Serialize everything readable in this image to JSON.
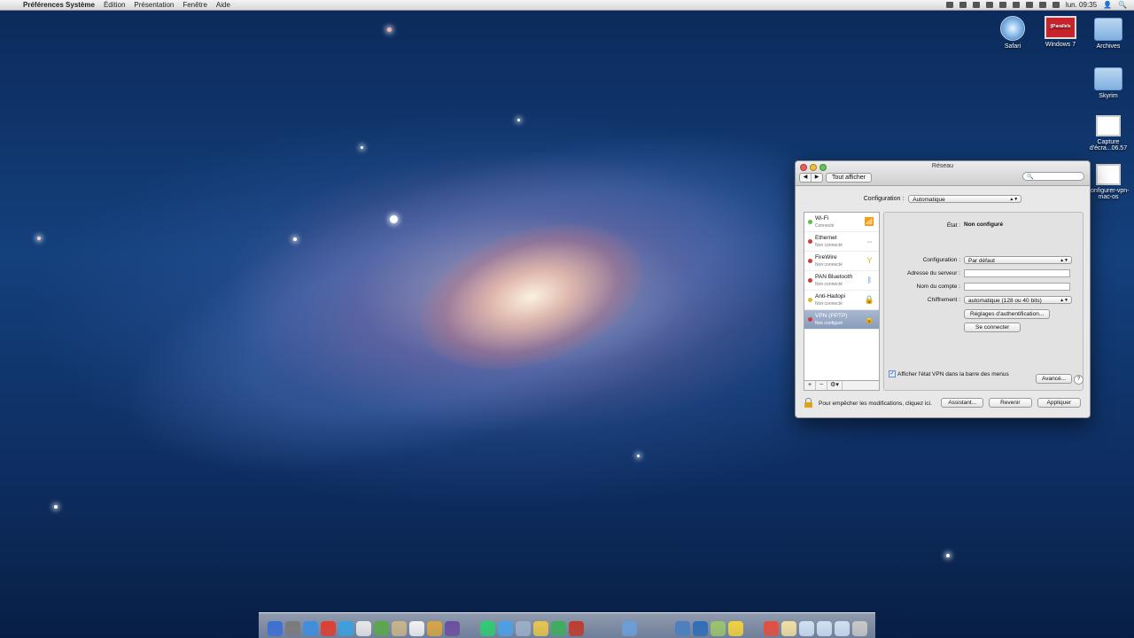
{
  "menubar": {
    "app_name": "Préférences Système",
    "menus": [
      "Édition",
      "Présentation",
      "Fenêtre",
      "Aide"
    ],
    "clock": "lun. 09:35",
    "apple_icon": "apple-icon"
  },
  "desktop_icons": [
    {
      "label": "Safari",
      "icon": "safari-icon"
    },
    {
      "label": "Windows 7",
      "icon": "parallels-icon",
      "badge": "||Parallels"
    },
    {
      "label": "Archives",
      "icon": "folder-icon"
    },
    {
      "label": "Skyrim",
      "icon": "folder-icon"
    },
    {
      "label": "Capture d'écra...06.57",
      "icon": "screenshot-icon"
    },
    {
      "label": "configurer-vpn-mac-os",
      "icon": "screenshot-icon"
    }
  ],
  "window": {
    "title": "Réseau",
    "show_all": "Tout afficher",
    "search_placeholder": "",
    "configuration_label": "Configuration :",
    "configuration_value": "Automatique",
    "services": [
      {
        "name": "Wi-Fi",
        "status": "Connecté",
        "dot_color": "#5cbf3c",
        "icon": "wifi-icon"
      },
      {
        "name": "Ethernet",
        "status": "Non connecté",
        "dot_color": "#d33b3b",
        "icon": "ethernet-icon"
      },
      {
        "name": "FireWire",
        "status": "Non connecté",
        "dot_color": "#d33b3b",
        "icon": "firewire-icon"
      },
      {
        "name": "PAN Bluetooth",
        "status": "Non connecté",
        "dot_color": "#d33b3b",
        "icon": "bluetooth-icon"
      },
      {
        "name": "Anti-Hadopi",
        "status": "Non connecté",
        "dot_color": "#e3b52a",
        "icon": "vpn-lock-icon"
      },
      {
        "name": "VPN (PPTP)",
        "status": "Non configuré",
        "dot_color": "#d33b3b",
        "icon": "vpn-lock-icon"
      }
    ],
    "sidebar_buttons": {
      "add": "+",
      "remove": "−",
      "gear": "⚙▾"
    },
    "panel": {
      "state_label": "État :",
      "state_value": "Non configuré",
      "config_label": "Configuration :",
      "config_value": "Par défaut",
      "server_label": "Adresse du serveur :",
      "server_value": "",
      "account_label": "Nom du compte :",
      "account_value": "",
      "encryption_label": "Chiffrement :",
      "encryption_value": "automatique (128 ou 40 bits)",
      "auth_button": "Réglages d'authentification...",
      "connect_button": "Se connecter",
      "show_vpn_label": "Afficher l'état VPN dans la barre des menus",
      "show_vpn_checked": true,
      "advanced_button": "Avancé...",
      "help_button": "?"
    },
    "lock_text": "Pour empêcher les modifications, cliquez ici.",
    "assistant_button": "Assistant...",
    "revert_button": "Revenir",
    "apply_button": "Appliquer"
  },
  "dock": {
    "item_colors": [
      "#3a6fd6",
      "#7a7a7a",
      "#3d8ee0",
      "#e23b2e",
      "#3aa0e0",
      "#e8e8e8",
      "#5aa84a",
      "#c9b48a",
      "#f2f2f2",
      "#d7a640",
      "#6a4ea0",
      "#333",
      "#2ecc71",
      "#4aa0e8",
      "#9bb0c8",
      "#e8c64a",
      "#3cae5a",
      "#c0392b",
      "#888",
      "#ddd",
      "#6a9fd8",
      "#555",
      "#999",
      "#4a7fc0",
      "#2d6db8",
      "#9bc46a",
      "#f2d23c",
      "#4a8",
      "#e74c3c",
      "#f0e0a0",
      "#cfe0f5",
      "#cfe0f5",
      "#cfe0f5",
      "#c8c8c8"
    ]
  }
}
